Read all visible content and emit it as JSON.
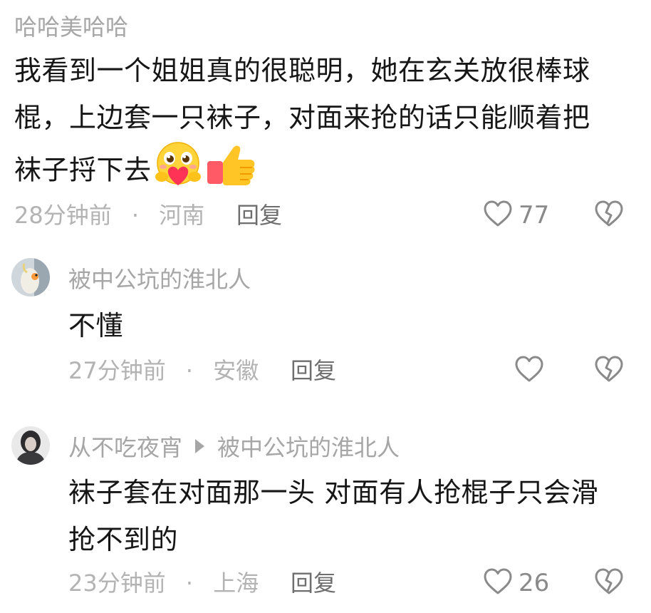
{
  "comments": [
    {
      "user": "哈哈美哈哈",
      "text_line1": "我看到一个姐姐真的很聪明，她在玄关放很棒球",
      "text_line2": "棍，上边套一只袜子，对面来抢的话只能顺着把",
      "text_line3": "袜子捋下去",
      "emojis": [
        "heart-hug-emoji",
        "thumbs-up-emoji"
      ],
      "time": "28分钟前",
      "dot": "·",
      "location": "河南",
      "reply_label": "回复",
      "likes": "77"
    },
    {
      "user": "被中公坑的淮北人",
      "text": "不懂",
      "time": "27分钟前",
      "dot": "·",
      "location": "安徽",
      "reply_label": "回复",
      "likes": ""
    },
    {
      "user": "从不吃夜宵",
      "reply_to": "被中公坑的淮北人",
      "text_line1": "袜子套在对面那一头 对面有人抢棍子只会滑",
      "text_line2": "抢不到的",
      "time": "23分钟前",
      "dot": "·",
      "location": "上海",
      "reply_label": "回复",
      "likes": "26"
    }
  ],
  "colors": {
    "username": "#a6a6a6",
    "meta": "#b3b3b3",
    "text": "#161616",
    "icon": "#8a8a8a"
  }
}
